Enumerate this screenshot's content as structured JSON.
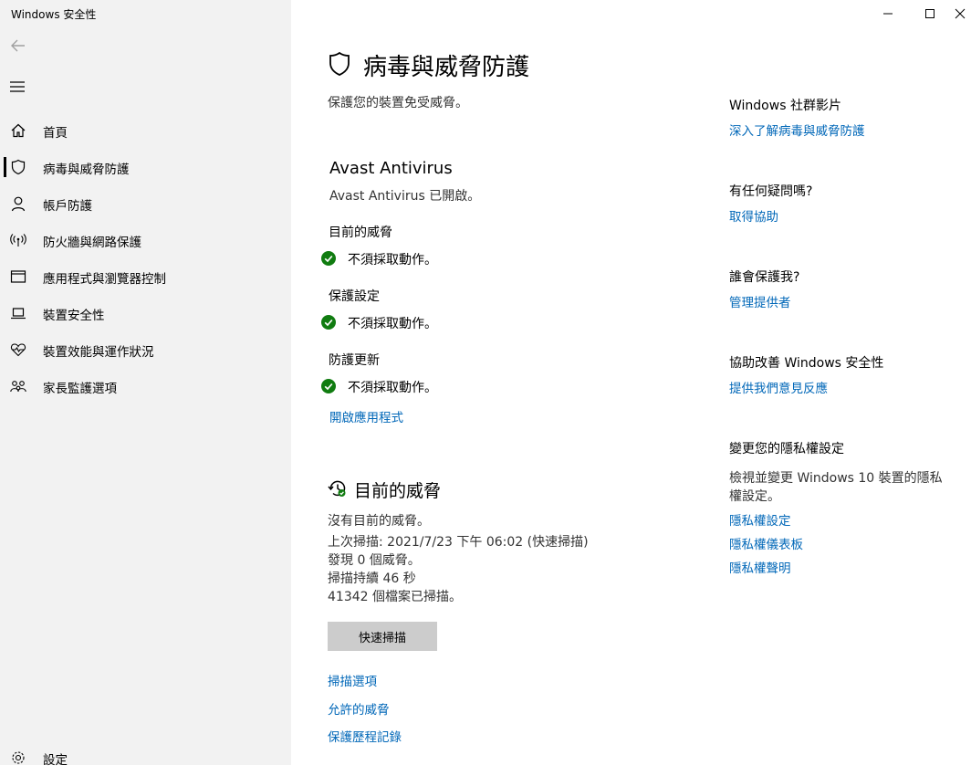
{
  "window": {
    "title": "Windows 安全性",
    "minimize": "—",
    "maximize": "☐",
    "close": "✕"
  },
  "sidebar": {
    "items": [
      {
        "label": "首頁",
        "icon": "home-icon"
      },
      {
        "label": "病毒與威脅防護",
        "icon": "shield-icon",
        "active": true
      },
      {
        "label": "帳戶防護",
        "icon": "person-icon"
      },
      {
        "label": "防火牆與網路保護",
        "icon": "antenna-icon"
      },
      {
        "label": "應用程式與瀏覽器控制",
        "icon": "browser-window-icon"
      },
      {
        "label": "裝置安全性",
        "icon": "laptop-icon"
      },
      {
        "label": "裝置效能與運作狀況",
        "icon": "heart-pulse-icon"
      },
      {
        "label": "家長監護選項",
        "icon": "family-icon"
      }
    ],
    "settings": "設定"
  },
  "main": {
    "title": "病毒與威脅防護",
    "subtitle": "保護您的裝置免受威脅。",
    "provider": {
      "name": "Avast Antivirus",
      "status": "Avast Antivirus 已開啟。",
      "sections": [
        {
          "header": "目前的威脅",
          "status": "不須採取動作。"
        },
        {
          "header": "保護設定",
          "status": "不須採取動作。"
        },
        {
          "header": "防護更新",
          "status": "不須採取動作。"
        }
      ],
      "open_app": "開啟應用程式"
    },
    "threats": {
      "title": "目前的威脅",
      "no_threats": "沒有目前的威脅。",
      "last_scan": "上次掃描: 2021/7/23 下午 06:02 (快速掃描)",
      "found": "發現 0 個威脅。",
      "duration": "掃描持續 46 秒",
      "files": "41342 個檔案已掃描。",
      "quick_scan": "快速掃描",
      "links": [
        "掃描選項",
        "允許的威脅",
        "保護歷程記錄"
      ]
    }
  },
  "right": {
    "community": {
      "header": "Windows 社群影片",
      "link": "深入了解病毒與威脅防護"
    },
    "help": {
      "header": "有任何疑問嗎?",
      "link": "取得協助"
    },
    "protector": {
      "header": "誰會保護我?",
      "link": "管理提供者"
    },
    "improve": {
      "header": "協助改善 Windows 安全性",
      "link": "提供我們意見反應"
    },
    "privacy": {
      "header": "變更您的隱私權設定",
      "desc_line1": "檢視並變更 Windows 10 裝置的隱私",
      "desc_line2": "權設定。",
      "links": [
        "隱私權設定",
        "隱私權儀表板",
        "隱私權聲明"
      ]
    }
  },
  "colors": {
    "accent": "#0067b8",
    "ok": "#107c10",
    "sidebar_bg": "#f2f2f2",
    "button_bg": "#cccccc"
  }
}
